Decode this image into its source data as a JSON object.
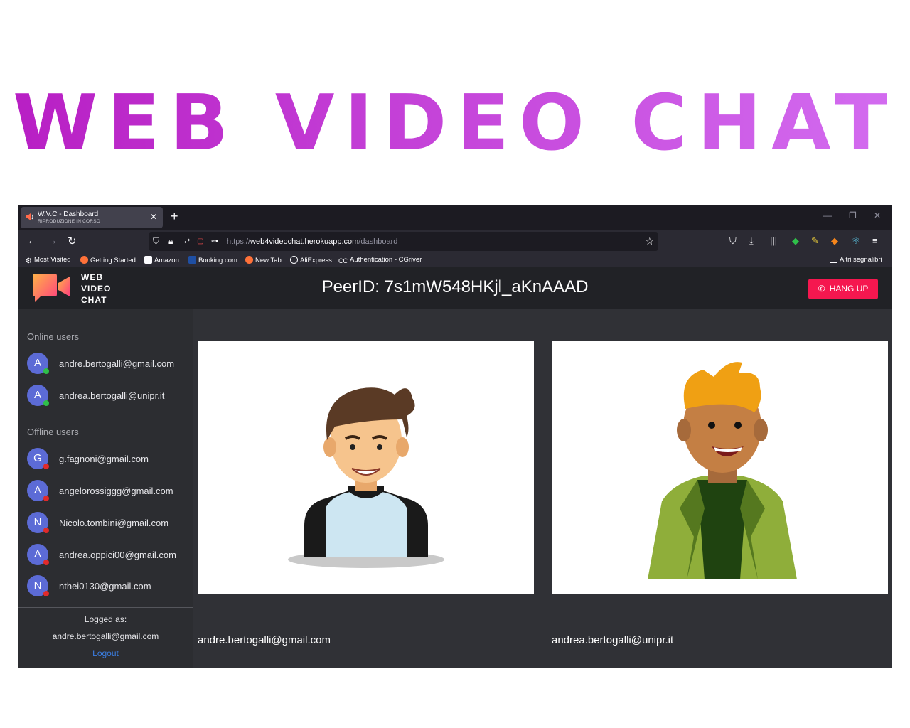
{
  "banner": {
    "title": "WEB VIDEO CHAT"
  },
  "browser": {
    "tab_title": "W.V.C - Dashboard",
    "tab_subtitle": "RIPRODUZIONE IN CORSO",
    "url_prefix": "https://",
    "url_domain": "web4videochat.herokuapp.com",
    "url_path": "/dashboard",
    "bookmarks": [
      "Most Visited",
      "Getting Started",
      "Amazon",
      "Booking.com",
      "New Tab",
      "AliExpress",
      "Authentication - CGriver"
    ],
    "other_bookmarks": "Altri segnalibri"
  },
  "app": {
    "logo_lines": [
      "WEB",
      "VIDEO",
      "CHAT"
    ],
    "peer_id": "PeerID: 7s1mW548HKjl_aKnAAAD",
    "hangup_label": "HANG UP",
    "online_title": "Online users",
    "offline_title": "Offline users",
    "online_users": [
      {
        "initial": "A",
        "email": "andre.bertogalli@gmail.com"
      },
      {
        "initial": "A",
        "email": "andrea.bertogalli@unipr.it"
      }
    ],
    "offline_users": [
      {
        "initial": "G",
        "email": "g.fagnoni@gmail.com"
      },
      {
        "initial": "A",
        "email": "angelorossiggg@gmail.com"
      },
      {
        "initial": "N",
        "email": "Nicolo.tombini@gmail.com"
      },
      {
        "initial": "A",
        "email": "andrea.oppici00@gmail.com"
      },
      {
        "initial": "N",
        "email": "nthei0130@gmail.com"
      }
    ],
    "logged_label": "Logged as:",
    "logged_user": "andre.bertogalli@gmail.com",
    "logout_label": "Logout",
    "videos": [
      {
        "name": "andre.bertogalli@gmail.com"
      },
      {
        "name": "andrea.bertogalli@unipr.it"
      }
    ]
  },
  "colors": {
    "accent_dark": "#b81fc4",
    "accent_light": "#d36cf0",
    "hangup": "#f5174f",
    "online": "#2fbf4a",
    "offline": "#e12a2a",
    "avatar": "#5c6bd6"
  }
}
